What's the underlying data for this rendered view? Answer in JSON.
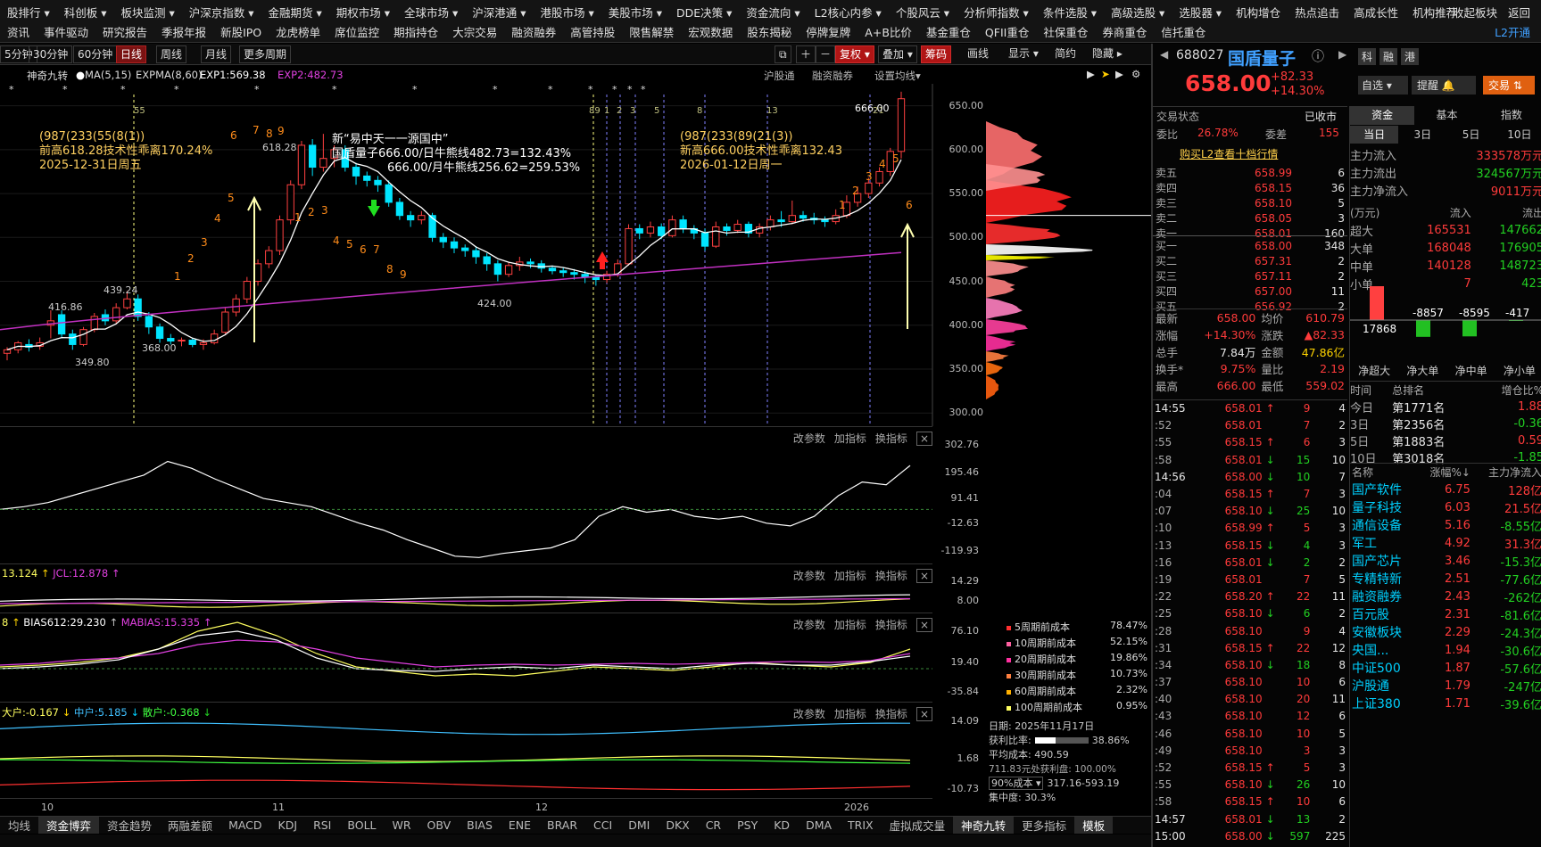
{
  "menu": {
    "row1": [
      "股排行",
      "科创板",
      "板块监测",
      "沪深京指数",
      "金融期货",
      "期权市场",
      "全球市场",
      "沪深港通",
      "港股市场",
      "美股市场",
      "DDE决策",
      "资金流向",
      "L2核心内参",
      "个股风云",
      "分析师指数",
      "条件选股",
      "高级选股",
      "选股器",
      "机构增仓",
      "热点追击",
      "高成长性",
      "机构推荐"
    ],
    "row1_right": [
      "收起板块",
      "返回"
    ],
    "row2": [
      "资讯",
      "事件驱动",
      "研究报告",
      "季报年报",
      "新股IPO",
      "龙虎榜单",
      "席位监控",
      "期指持仓",
      "大宗交易",
      "融资融券",
      "高管持股",
      "限售解禁",
      "宏观数据",
      "股东揭秘",
      "停牌复牌",
      "A+B比价",
      "基金重仓",
      "QFII重仓",
      "社保重仓",
      "券商重仓",
      "信托重仓"
    ],
    "row2_right": [
      "L2开通"
    ]
  },
  "periods": [
    "5分钟",
    "30分钟",
    "60分钟",
    "日线",
    "周线",
    "月线",
    "更多周期"
  ],
  "selected_period": "日线",
  "tools": {
    "fuquan": "复权",
    "overlay": "叠加",
    "chips": "筹码",
    "draw": "画线",
    "display": "显示",
    "simple": "简约",
    "hide": "隐藏"
  },
  "chart_header": {
    "name": "神奇九转",
    "ma": "MA(5,15)",
    "expma": "EXPMA(8,60)",
    "exp1": "EXP1:569.38",
    "exp2": "EXP2:482.73",
    "hgt": "沪股通",
    "rzrq": "融资融券",
    "setma": "设置均线"
  },
  "annotations": {
    "a1_l1": "(987(233(55(8(1))",
    "a1_l2": "前高618.28技术性乖离170.24%",
    "a1_l3": "2025-12-31日周五",
    "a2_l1": "新“易中天一一源国中”",
    "a2_l2": "国盾量子666.00/日牛熊线482.73=132.43%",
    "a2_l3": "666.00/月牛熊线256.62=259.53%",
    "a3_l1": "(987(233(89(21(3))",
    "a3_l2": "新高666.00技术性乖离132.43",
    "a3_l3": "2026-01-12日周一",
    "p_high": "666.00",
    "p_618": "618.28",
    "p_439": "439.24",
    "p_416": "416.86",
    "p_368": "368.00",
    "p_349": "349.80",
    "p_424": "424.00"
  },
  "chart_data": {
    "type": "candlestick",
    "y_ticks": [
      "650.00",
      "600.00",
      "550.00",
      "500.00",
      "450.00",
      "400.00",
      "350.00",
      "300.00"
    ],
    "ylim": [
      285,
      675
    ],
    "x_labels": [
      "10",
      "11",
      "12",
      "2026"
    ],
    "candles": [
      [
        368,
        372,
        360,
        375
      ],
      [
        372,
        380,
        368,
        382
      ],
      [
        378,
        375,
        370,
        384
      ],
      [
        376,
        380,
        372,
        386
      ],
      [
        400,
        405,
        385,
        417
      ],
      [
        412,
        390,
        385,
        417
      ],
      [
        390,
        378,
        372,
        395
      ],
      [
        378,
        395,
        376,
        398
      ],
      [
        395,
        410,
        392,
        414
      ],
      [
        412,
        405,
        400,
        418
      ],
      [
        405,
        420,
        402,
        425
      ],
      [
        420,
        430,
        418,
        439
      ],
      [
        430,
        410,
        405,
        435
      ],
      [
        410,
        398,
        390,
        415
      ],
      [
        398,
        385,
        380,
        402
      ],
      [
        385,
        382,
        378,
        390
      ],
      [
        382,
        383,
        376,
        386
      ],
      [
        383,
        378,
        375,
        385
      ],
      [
        378,
        380,
        372,
        384
      ],
      [
        380,
        390,
        378,
        395
      ],
      [
        392,
        415,
        390,
        420
      ],
      [
        415,
        430,
        410,
        435
      ],
      [
        430,
        450,
        425,
        455
      ],
      [
        450,
        470,
        445,
        475
      ],
      [
        470,
        485,
        465,
        490
      ],
      [
        485,
        520,
        480,
        525
      ],
      [
        520,
        560,
        515,
        565
      ],
      [
        560,
        605,
        555,
        610
      ],
      [
        605,
        580,
        570,
        612
      ],
      [
        580,
        590,
        575,
        618
      ],
      [
        590,
        600,
        580,
        605
      ],
      [
        600,
        580,
        575,
        605
      ],
      [
        580,
        570,
        560,
        585
      ],
      [
        570,
        565,
        558,
        575
      ],
      [
        565,
        560,
        552,
        570
      ],
      [
        560,
        540,
        535,
        565
      ],
      [
        540,
        525,
        520,
        545
      ],
      [
        525,
        520,
        512,
        530
      ],
      [
        520,
        525,
        515,
        530
      ],
      [
        525,
        500,
        495,
        528
      ],
      [
        500,
        495,
        488,
        505
      ],
      [
        495,
        488,
        482,
        500
      ],
      [
        488,
        485,
        478,
        492
      ],
      [
        485,
        478,
        470,
        490
      ],
      [
        478,
        470,
        462,
        482
      ],
      [
        470,
        458,
        450,
        474
      ],
      [
        458,
        468,
        455,
        472
      ],
      [
        468,
        472,
        462,
        478
      ],
      [
        472,
        470,
        465,
        476
      ],
      [
        470,
        465,
        460,
        474
      ],
      [
        465,
        462,
        458,
        468
      ],
      [
        462,
        460,
        455,
        466
      ],
      [
        460,
        458,
        452,
        464
      ],
      [
        458,
        455,
        448,
        462
      ],
      [
        455,
        452,
        445,
        458
      ],
      [
        452,
        458,
        448,
        462
      ],
      [
        458,
        470,
        455,
        475
      ],
      [
        470,
        510,
        468,
        515
      ],
      [
        510,
        505,
        498,
        515
      ],
      [
        505,
        512,
        500,
        518
      ],
      [
        512,
        502,
        498,
        516
      ],
      [
        502,
        520,
        500,
        525
      ],
      [
        520,
        510,
        505,
        525
      ],
      [
        510,
        505,
        498,
        514
      ],
      [
        505,
        490,
        485,
        510
      ],
      [
        490,
        512,
        488,
        518
      ],
      [
        512,
        508,
        502,
        516
      ],
      [
        508,
        515,
        505,
        520
      ],
      [
        515,
        505,
        500,
        518
      ],
      [
        505,
        512,
        500,
        516
      ],
      [
        512,
        520,
        508,
        525
      ],
      [
        520,
        518,
        512,
        530
      ],
      [
        518,
        525,
        515,
        542
      ],
      [
        525,
        522,
        518,
        530
      ],
      [
        522,
        520,
        515,
        528
      ],
      [
        520,
        518,
        512,
        524
      ],
      [
        518,
        525,
        515,
        532
      ],
      [
        525,
        540,
        522,
        548
      ],
      [
        540,
        550,
        535,
        558
      ],
      [
        550,
        562,
        545,
        568
      ],
      [
        562,
        575,
        558,
        580
      ],
      [
        575,
        598,
        570,
        602
      ],
      [
        598,
        658,
        590,
        666
      ]
    ],
    "exp2_start": 395,
    "exp2_end": 482.73
  },
  "panels": {
    "p1": {
      "ticks": [
        "302.76",
        "195.46",
        "91.41",
        "-12.63",
        "-119.93"
      ],
      "btns": [
        "改参数",
        "加指标",
        "换指标"
      ]
    },
    "p2": {
      "label_a": "13.124",
      "label_b": "JCL:12.878",
      "ticks": [
        "14.29",
        "8.00"
      ]
    },
    "p3": {
      "label_a": "8",
      "label_b": "BIAS612:29.230",
      "label_c": "MABIAS:15.335",
      "ticks": [
        "76.10",
        "19.40",
        "-35.84"
      ]
    },
    "p4": {
      "label_a": "大户:-0.167",
      "label_b": "中户:5.185",
      "label_c": "散户:-0.368",
      "ticks": [
        "14.09",
        "1.68",
        "-10.73"
      ]
    }
  },
  "cost": {
    "rows": [
      [
        "5周期前成本",
        "78.47%"
      ],
      [
        "10周期前成本",
        "52.15%"
      ],
      [
        "20周期前成本",
        "19.86%"
      ],
      [
        "30周期前成本",
        "10.73%"
      ],
      [
        "60周期前成本",
        "2.32%"
      ],
      [
        "100周期前成本",
        "0.95%"
      ]
    ],
    "date": "日期: 2025年11月17日",
    "profit_label": "获利比率:",
    "profit": "38.86%",
    "avg": "平均成本: 490.59",
    "chip_text": "711.83元处获利盘: 100.00%",
    "mode": "90%成本",
    "range": "317.16-593.19",
    "conc": "集中度: 30.3%"
  },
  "stock": {
    "code": "688027",
    "name": "国盾量子",
    "price": "658.00",
    "chg": "+82.33",
    "pct": "+14.30%",
    "btn_self": "自选",
    "btn_alert": "提醒",
    "btn_trade": "交易",
    "side_tabs": [
      "科",
      "融",
      "港"
    ],
    "status_label": "交易状态",
    "status": "已收市",
    "wb_label": "委比",
    "wb": "26.78%",
    "wc_label": "委差",
    "wc": "155",
    "l2": "购买L2查看十档行情"
  },
  "orderbook": {
    "sell": [
      [
        "卖五",
        "658.99",
        "6"
      ],
      [
        "卖四",
        "658.15",
        "36"
      ],
      [
        "卖三",
        "658.10",
        "5"
      ],
      [
        "卖二",
        "658.05",
        "3"
      ],
      [
        "卖一",
        "658.01",
        "160"
      ]
    ],
    "buy": [
      [
        "买一",
        "658.00",
        "348"
      ],
      [
        "买二",
        "657.31",
        "2"
      ],
      [
        "买三",
        "657.11",
        "2"
      ],
      [
        "买四",
        "657.00",
        "11"
      ],
      [
        "买五",
        "656.92",
        "2"
      ]
    ]
  },
  "quote": [
    [
      "最新",
      "658.00",
      "均价",
      "610.79"
    ],
    [
      "涨幅",
      "+14.30%",
      "涨跌",
      "▲82.33"
    ],
    [
      "总手",
      "7.84万",
      "金额",
      "47.86亿"
    ],
    [
      "换手*",
      "9.75%",
      "量比",
      "2.19"
    ],
    [
      "最高",
      "666.00",
      "最低",
      "559.02"
    ]
  ],
  "ticks": [
    [
      "14:55",
      "658.01",
      "↑",
      "9",
      "4"
    ],
    [
      ":52",
      "658.01",
      "",
      "7",
      "2"
    ],
    [
      ":55",
      "658.15",
      "↑",
      "6",
      "3"
    ],
    [
      ":58",
      "658.01",
      "↓",
      "15",
      "10"
    ],
    [
      "14:56",
      "658.00",
      "↓",
      "10",
      "7"
    ],
    [
      ":04",
      "658.15",
      "↑",
      "7",
      "3"
    ],
    [
      ":07",
      "658.10",
      "↓",
      "25",
      "10"
    ],
    [
      ":10",
      "658.99",
      "↑",
      "5",
      "3"
    ],
    [
      ":13",
      "658.15",
      "↓",
      "4",
      "3"
    ],
    [
      ":16",
      "658.01",
      "↓",
      "2",
      "2"
    ],
    [
      ":19",
      "658.01",
      "",
      "7",
      "5"
    ],
    [
      ":22",
      "658.20",
      "↑",
      "22",
      "11"
    ],
    [
      ":25",
      "658.10",
      "↓",
      "6",
      "2"
    ],
    [
      ":28",
      "658.10",
      "",
      "9",
      "4"
    ],
    [
      ":31",
      "658.15",
      "↑",
      "22",
      "12"
    ],
    [
      ":34",
      "658.10",
      "↓",
      "18",
      "8"
    ],
    [
      ":37",
      "658.10",
      "",
      "10",
      "6"
    ],
    [
      ":40",
      "658.10",
      "",
      "20",
      "11"
    ],
    [
      ":43",
      "658.10",
      "",
      "12",
      "6"
    ],
    [
      ":46",
      "658.10",
      "",
      "10",
      "5"
    ],
    [
      ":49",
      "658.10",
      "",
      "3",
      "3"
    ],
    [
      ":52",
      "658.15",
      "↑",
      "5",
      "3"
    ],
    [
      ":55",
      "658.10",
      "↓",
      "26",
      "10"
    ],
    [
      ":58",
      "658.15",
      "↑",
      "10",
      "6"
    ],
    [
      "14:57",
      "658.01",
      "↓",
      "13",
      "2"
    ],
    [
      "15:00",
      "658.00",
      "↓",
      "597",
      "225"
    ]
  ],
  "fund": {
    "tabs": [
      "资金",
      "基本",
      "指数"
    ],
    "periods": [
      "当日",
      "3日",
      "5日",
      "10日"
    ],
    "flow": [
      [
        "主力流入",
        "333578万元"
      ],
      [
        "主力流出",
        "324567万元"
      ],
      [
        "主力净流入",
        "9011万元"
      ]
    ],
    "head": [
      "(万元)",
      "流入",
      "流出"
    ],
    "rows": [
      [
        "超大",
        "165531",
        "147662"
      ],
      [
        "大单",
        "168048",
        "176905"
      ],
      [
        "中单",
        "140128",
        "148723"
      ],
      [
        "小单",
        "7",
        "423"
      ]
    ],
    "bars": [
      "17868",
      "-8857",
      "-8595",
      "-417"
    ],
    "bar_labels": [
      "净超大",
      "净大单",
      "净中单",
      "净小单"
    ],
    "rank_head": [
      "时间",
      "总排名",
      "增仓比%"
    ],
    "rank": [
      [
        "今日",
        "第1771名",
        "1.88"
      ],
      [
        "3日",
        "第2356名",
        "-0.36"
      ],
      [
        "5日",
        "第1883名",
        "0.59"
      ],
      [
        "10日",
        "第3018名",
        "-1.85"
      ]
    ],
    "sect_head": [
      "名称",
      "涨幅%↓",
      "主力净流入"
    ],
    "sectors": [
      [
        "国产软件",
        "6.75",
        "128亿"
      ],
      [
        "量子科技",
        "6.03",
        "21.5亿"
      ],
      [
        "通信设备",
        "5.16",
        "-8.55亿"
      ],
      [
        "军工",
        "4.92",
        "31.3亿"
      ],
      [
        "国产芯片",
        "3.46",
        "-15.3亿"
      ],
      [
        "专精特新",
        "2.51",
        "-77.6亿"
      ],
      [
        "融资融券",
        "2.43",
        "-262亿"
      ],
      [
        "百元股",
        "2.31",
        "-81.6亿"
      ],
      [
        "安徽板块",
        "2.29",
        "-24.3亿"
      ],
      [
        "央国...",
        "1.94",
        "-30.6亿"
      ],
      [
        "中证500",
        "1.87",
        "-57.6亿"
      ],
      [
        "沪股通",
        "1.79",
        "-247亿"
      ],
      [
        "上证380",
        "1.71",
        "-39.6亿"
      ]
    ]
  },
  "bottom_tabs": [
    "均线",
    "资金博弈",
    "资金趋势",
    "两融差额",
    "MACD",
    "KDJ",
    "RSI",
    "BOLL",
    "WR",
    "OBV",
    "BIAS",
    "ENE",
    "BRAR",
    "CCI",
    "DMI",
    "DKX",
    "CR",
    "PSY",
    "KD",
    "DMA",
    "TRIX",
    "虚拟成交量",
    "神奇九转",
    "更多指标",
    "模板"
  ]
}
